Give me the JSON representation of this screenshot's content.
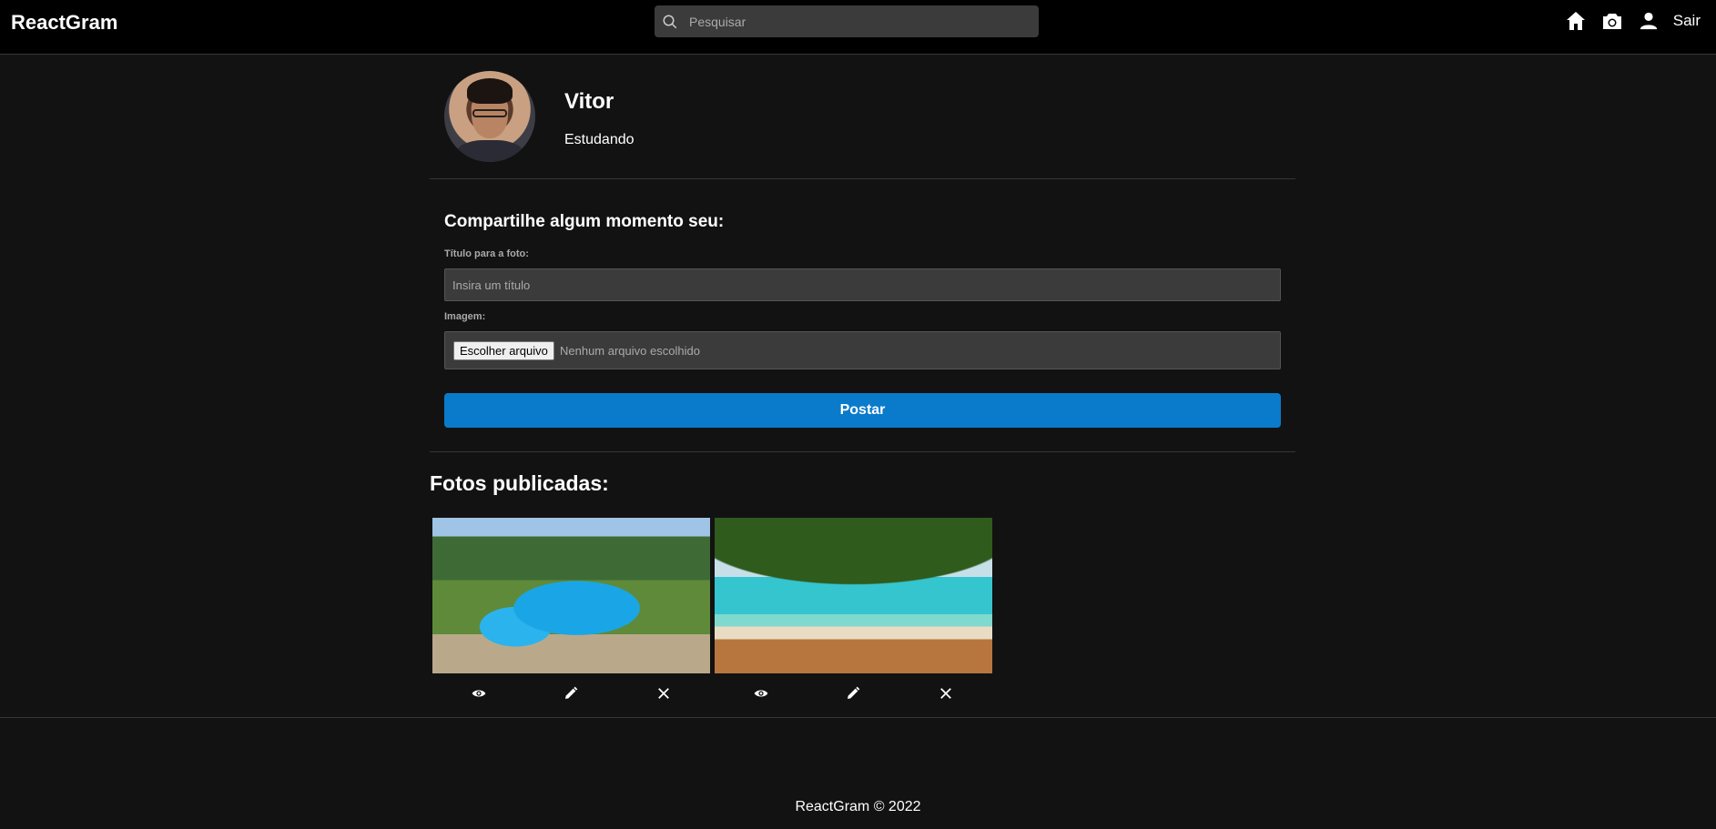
{
  "navbar": {
    "brand": "ReactGram",
    "search_placeholder": "Pesquisar",
    "icons": [
      "home-icon",
      "camera-icon",
      "user-icon"
    ],
    "logout_label": "Sair"
  },
  "profile": {
    "name": "Vitor",
    "bio": "Estudando"
  },
  "new_photo": {
    "heading": "Compartilhe algum momento seu:",
    "title_label": "Título para a foto:",
    "title_placeholder": "Insira um título",
    "image_label": "Imagem:",
    "file_button_label": "Escolher arquivo",
    "file_status": "Nenhum arquivo escolhido",
    "submit_label": "Postar"
  },
  "gallery": {
    "heading": "Fotos publicadas:",
    "photos": [
      {
        "subject": "resort pool with palm trees",
        "actions": [
          "eye-icon",
          "pencil-icon",
          "close-icon"
        ]
      },
      {
        "subject": "tropical beach under tree",
        "actions": [
          "eye-icon",
          "pencil-icon",
          "close-icon"
        ]
      }
    ]
  },
  "footer": {
    "text": "ReactGram © 2022"
  },
  "colors": {
    "background": "#121212",
    "navbar": "#000000",
    "input": "#3b3b3b",
    "accent": "#0a7bcb"
  }
}
